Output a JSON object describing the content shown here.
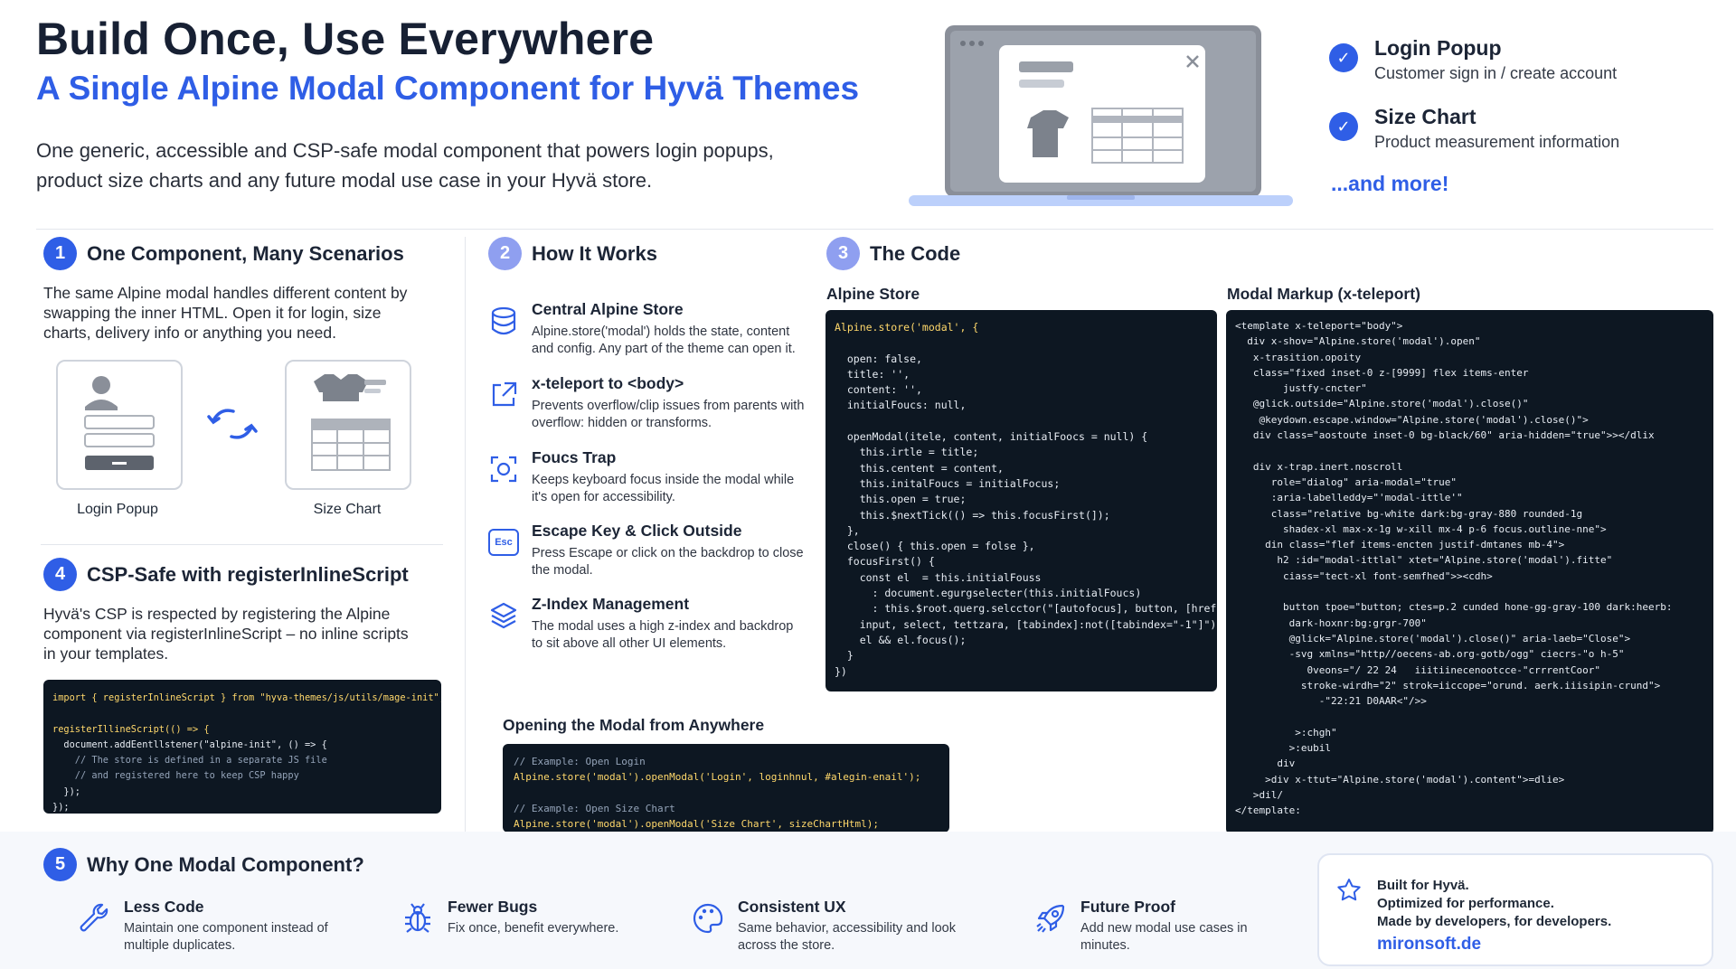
{
  "header": {
    "title": "Build Once, Use Everywhere",
    "subtitle": "A Single Alpine Modal Component for Hyvä Themes",
    "intro": "One generic, accessible and CSP-safe modal component that powers login popups, product size charts and any future modal use case in your Hyvä store."
  },
  "hero_list": {
    "items": [
      {
        "title": "Login Popup",
        "subtitle": "Customer sign in / create account"
      },
      {
        "title": "Size Chart",
        "subtitle": "Product measurement information"
      }
    ],
    "more": "...and more!"
  },
  "section1": {
    "number": "1",
    "title": "One Component, Many Scenarios",
    "text": "The same Alpine modal handles different content by swapping the inner HTML. Open it for login, size charts, delivery info or anything you need.",
    "cards": [
      "Login Popup",
      "Size Chart"
    ]
  },
  "section2": {
    "number": "2",
    "title": "How It Works",
    "items": [
      {
        "icon": "database-icon",
        "title": "Central Alpine Store",
        "desc": "Alpine.store('modal') holds the state, content and config. Any part of the theme can open it."
      },
      {
        "icon": "external-link-icon",
        "title": "x-teleport to <body>",
        "desc": "Prevents overflow/clip issues from parents with overflow: hidden or transforms."
      },
      {
        "icon": "focus-target-icon",
        "title": "Foucs Trap",
        "desc": "Keeps keyboard focus inside the modal while it's open for accessibility."
      },
      {
        "icon": "esc-key-icon",
        "title": "Escape Key & Click Outside",
        "desc": "Press Escape or click on the backdrop to close the modal."
      },
      {
        "icon": "layers-icon",
        "title": "Z-Index Management",
        "desc": "The modal uses a high z-index and backdrop to sit above all other UI elements."
      }
    ],
    "esc_key_text": "Esc"
  },
  "section3": {
    "number": "3",
    "title": "The Code",
    "store_label": "Alpine Store",
    "store_code": [
      "Alpine.store('modal', {",
      "",
      "  open: false,",
      "  title: '',",
      "  content: '',",
      "  initialFoucs: null,",
      "",
      "  openModal(itele, content, initialFoocs = null) {",
      "    this.irtle = title;",
      "    this.centent = content,",
      "    this.initalFoucs = initialFocus;",
      "    this.open = true;",
      "    this.$nextTick(() => this.focusFirst(]);",
      "  },",
      "  close() { this.open = folse },",
      "  focusFirst() {",
      "    const el  = this.initialFouss",
      "      : document.egurgselecter(this.initialFoucs)",
      "      : this.$root.querg.selcctor(\"[autofocus], button, [href],",
      "    input, select, tettzara, [tabindex]:not([tabindex=\"-1\"]\")),",
      "    el && el.focus();",
      "  }",
      "})"
    ],
    "markup_label": "Modal Markup (x-teleport)",
    "markup_code": [
      "<template x-teleport=\"body\">",
      "  div x-shov=\"Alpine.store('modal').open\"",
      "   x-trasition.opoity",
      "   class=\"fixed inset-0 z-[9999] flex items-enter",
      "        justfy-cncter\"",
      "   @glick.outside=\"Alpine.store('modal').close()\"",
      "    @keydown.escape.window=\"Alpine.store('modal').close()\">",
      "   div class=\"aostoute inset-0 bg-black/60\" aria-hidden=\"true\">></dlix",
      "",
      "   div x-trap.inert.noscroll",
      "      role=\"dialog\" aria-modal=\"true\"",
      "      :aria-labelleddy=\"'modal-ittle'\"",
      "      class=\"relative bg-white dark:bg-gray-880 rounded-1g",
      "        shadex-xl max-x-1g w-xill mx-4 p-6 focus.outline-nne\">",
      "     din class=\"flef items-encten justif-dmtanes mb-4\">",
      "       h2 :id=\"modal-ittlal\" xtet=\"Alpine.store('modal').fitte\"",
      "        ciass=\"tect-xl font-semfhed\">><cdh>",
      "",
      "        button tpoe=\"button; ctes=p.2 cunded hone-gg-gray-100 dark:heerb:",
      "         dark-hoxnr:bg:grgr-700\"",
      "         @glick=\"Alpine.store('modal').close()\" aria-laeb=\"Close\">",
      "         -svg xmlns=\"http//oecens-ab.org-gotb/ogg\" ciecrs-\"o h-5\"",
      "            0veons=\"/ 22 24   iiitiinecenootcce-\"crrrentCoor\"",
      "           stroke-wirdh=\"2\" strok=iiccope=\"orund. aerk.iiisipin-crund\">",
      "              -\"22:21 D0AAR<\"/>>",
      "",
      "          >:chgh\"",
      "         >:eubil",
      "       div",
      "     >div x-ttut=\"Alpine.store('modal').content\">=dlie>",
      "   >dil/",
      "</template:"
    ],
    "opening_label": "Opening the Modal from Anywhere",
    "opening_code": [
      "// Example: Open Login",
      "Alpine.store('modal').openModal('Login', loginhnul, #alegin-enail');",
      "",
      "// Example: Open Size Chart",
      "Alpine.store('modal').openModal('Size Chart', sizeChartHtml);"
    ]
  },
  "section4": {
    "number": "4",
    "title": "CSP-Safe with registerInlineScript",
    "text": "Hyvä's CSP is respected by registering the Alpine component via registerInlineScript – no inline scripts in your templates.",
    "code": [
      "import { registerInlineScript } from \"hyva-themes/js/utils/mage-init\";",
      "",
      "registerIllineScript(() => {",
      "  document.addEentllstener(\"alpine-init\", () => {",
      "    // The store is defined in a separate JS file",
      "    // and registered here to keep CSP happy",
      "  });",
      "});"
    ]
  },
  "section5": {
    "number": "5",
    "title": "Why One Modal Component?",
    "benefits": [
      {
        "icon": "wrench-icon",
        "title": "Less Code",
        "desc": "Maintain one component instead of multiple duplicates."
      },
      {
        "icon": "bug-icon",
        "title": "Fewer Bugs",
        "desc": "Fix once, benefit everywhere."
      },
      {
        "icon": "palette-icon",
        "title": "Consistent UX",
        "desc": "Same behavior, accessibility and look across the store."
      },
      {
        "icon": "rocket-icon",
        "title": "Future Proof",
        "desc": "Add new modal use cases in minutes."
      }
    ]
  },
  "credit": {
    "line1": "Built for Hyvä.",
    "line2": "Optimized for performance.",
    "line3": "Made by developers, for developers.",
    "link": "mironsoft.de"
  },
  "colors": {
    "accent": "#2f5ee6",
    "code_bg": "#0d1722",
    "title": "#172033"
  }
}
